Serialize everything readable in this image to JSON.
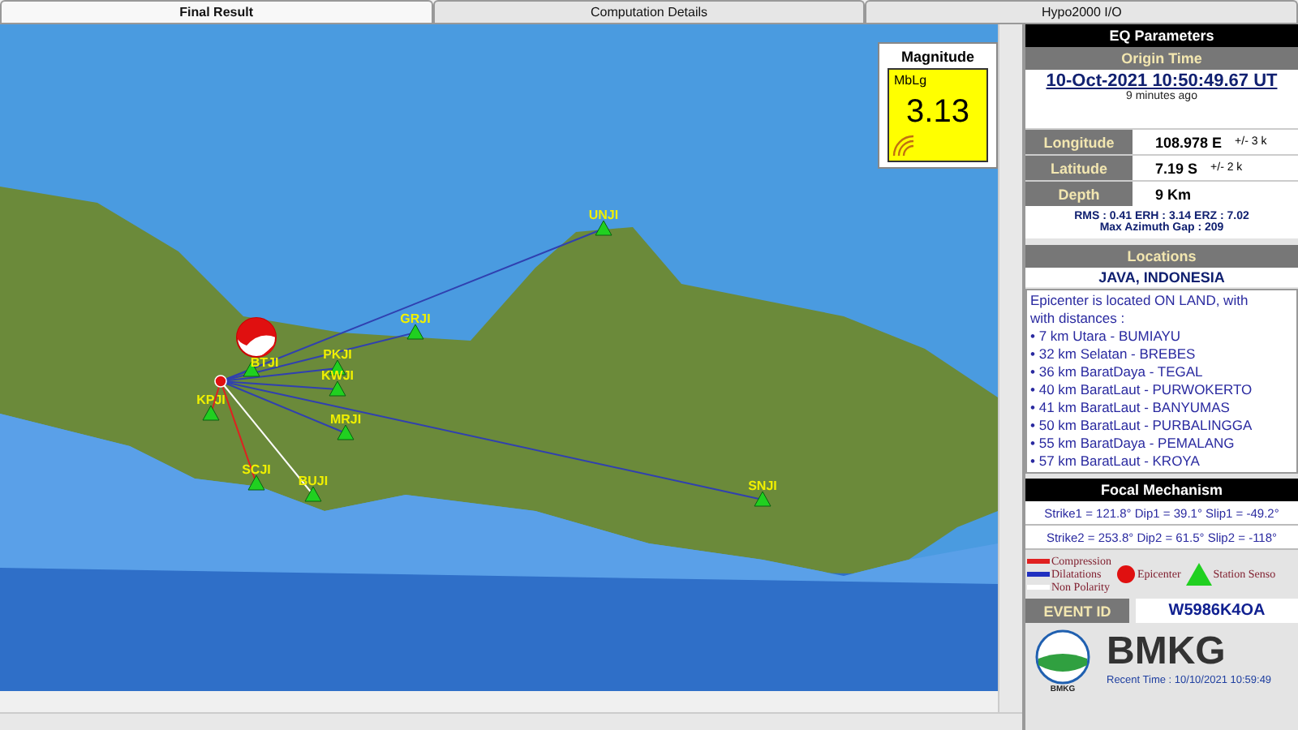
{
  "tabs": [
    {
      "label": "Final Result",
      "selected": true
    },
    {
      "label": "Computation Details",
      "selected": false
    },
    {
      "label": "Hypo2000 I/O",
      "selected": false
    }
  ],
  "map": {
    "stations": [
      {
        "code": "UNJI",
        "color": "#3040b0"
      },
      {
        "code": "GRJI",
        "color": "#3040b0"
      },
      {
        "code": "BTJI",
        "color": "#3040b0"
      },
      {
        "code": "PKJI",
        "color": "#3040b0"
      },
      {
        "code": "KWJI",
        "color": "#3040b0"
      },
      {
        "code": "KPJI",
        "color": "#e02020"
      },
      {
        "code": "MRJI",
        "color": "#3040b0"
      },
      {
        "code": "SCJI",
        "color": "#e02020"
      },
      {
        "code": "BUJI",
        "color": "#ffffff"
      },
      {
        "code": "SNJI",
        "color": "#3040b0"
      }
    ]
  },
  "magnitude": {
    "title": "Magnitude",
    "type": "MbLg",
    "value": "3.13"
  },
  "eq_parameters": {
    "title": "EQ Parameters",
    "origin_time_header": "Origin Time",
    "origin_time": "10-Oct-2021 10:50:49.67 UT",
    "ago": "9 minutes  ago",
    "rows": [
      {
        "label": "Longitude",
        "value": "108.978 E",
        "error": "+/- 3 k"
      },
      {
        "label": "Latitude",
        "value": "7.19 S",
        "error": "+/- 2 k"
      },
      {
        "label": "Depth",
        "value": "9 Km"
      }
    ],
    "stats": "RMS : 0.41   ERH : 3.14   ERZ : 7.02",
    "azimuth_gap": "Max Azimuth Gap : 209"
  },
  "locations": {
    "title": "Locations",
    "region": "JAVA, INDONESIA",
    "description": "Epicenter is located ON LAND, with with distances :",
    "distances": [
      "• 7 km Utara - BUMIAYU",
      "• 32 km Selatan - BREBES",
      "• 36 km BaratDaya - TEGAL",
      "• 40 km BaratLaut - PURWOKERTO",
      "• 41 km BaratLaut - BANYUMAS",
      "• 50 km BaratLaut - PURBALINGGA",
      "• 55 km BaratDaya - PEMALANG",
      "• 57 km BaratLaut - KROYA"
    ]
  },
  "focal_mechanism": {
    "title": "Focal Mechanism",
    "lines": [
      "Strike1 = 121.8° Dip1 = 39.1° Slip1 = -49.2°",
      "Strike2 = 253.8° Dip2 = 61.5° Slip2 = -118°"
    ]
  },
  "legend": [
    {
      "kind": "line",
      "label": "Compression",
      "color": "#e02020"
    },
    {
      "kind": "line",
      "label": "Dilatations",
      "color": "#2030c0"
    },
    {
      "kind": "line",
      "label": "Non Polarity",
      "color": "#ffffff"
    },
    {
      "kind": "circle",
      "label": "Epicenter",
      "color": "#e01010"
    },
    {
      "kind": "triangle",
      "label": "Station Senso",
      "color": "#20d020"
    }
  ],
  "event": {
    "label": "EVENT ID",
    "value": "W5986K4OA"
  },
  "agency": {
    "name": "BMKG",
    "logo_caption": "BMKG",
    "recent_time": "Recent Time : 10/10/2021 10:59:49"
  }
}
